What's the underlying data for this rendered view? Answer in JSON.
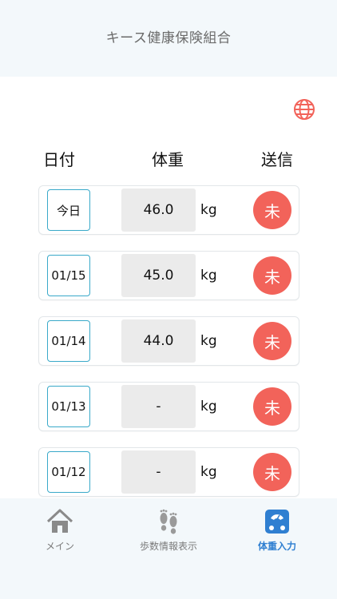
{
  "header": {
    "title": "キース健康保険組合"
  },
  "icons": {
    "language": "globe-icon",
    "home": "home-icon",
    "steps": "footprints-icon",
    "weight": "scale-icon"
  },
  "colors": {
    "accent_red": "#f2635a",
    "accent_blue": "#2f7fd1",
    "date_border": "#39a9c9",
    "header_bg": "#f3f8fb"
  },
  "columns": {
    "date": "日付",
    "weight": "体重",
    "send": "送信"
  },
  "rows": [
    {
      "date": "今日",
      "weight": "46.0",
      "unit": "kg",
      "status": "未"
    },
    {
      "date": "01/15",
      "weight": "45.0",
      "unit": "kg",
      "status": "未"
    },
    {
      "date": "01/14",
      "weight": "44.0",
      "unit": "kg",
      "status": "未"
    },
    {
      "date": "01/13",
      "weight": "-",
      "unit": "kg",
      "status": "未"
    },
    {
      "date": "01/12",
      "weight": "-",
      "unit": "kg",
      "status": "未"
    }
  ],
  "tabs": [
    {
      "label": "メイン"
    },
    {
      "label": "歩数情報表示"
    },
    {
      "label": "体重入力"
    }
  ]
}
